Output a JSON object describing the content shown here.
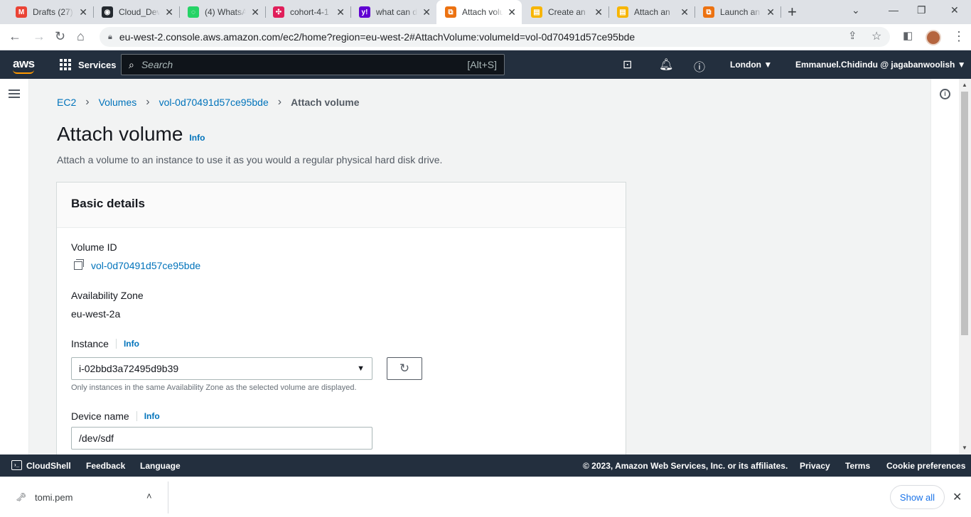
{
  "browser": {
    "tabs": [
      {
        "title": "Drafts (27)",
        "icon": "gmail-icon",
        "color": "#ea4335",
        "glyph": "M"
      },
      {
        "title": "Cloud_Dev",
        "icon": "github-icon",
        "color": "#24292f",
        "glyph": "◉"
      },
      {
        "title": "(4) WhatsA",
        "icon": "whatsapp-icon",
        "color": "#25d366",
        "glyph": "◌"
      },
      {
        "title": "cohort-4-1",
        "icon": "slack-icon",
        "color": "#e01e5a",
        "glyph": "✣"
      },
      {
        "title": "what can d",
        "icon": "yahoo-icon",
        "color": "#6001d2",
        "glyph": "y!"
      },
      {
        "title": "Attach volu",
        "icon": "aws-ec2-icon",
        "color": "#ec7211",
        "glyph": "⧉",
        "active": true
      },
      {
        "title": "Create an",
        "icon": "aws-docs-icon",
        "color": "#f7b500",
        "glyph": "▤"
      },
      {
        "title": "Attach an",
        "icon": "aws-docs-icon",
        "color": "#f7b500",
        "glyph": "▤"
      },
      {
        "title": "Launch an",
        "icon": "aws-ec2-icon",
        "color": "#ec7211",
        "glyph": "⧉"
      }
    ],
    "new_tab": "+",
    "url": "eu-west-2.console.aws.amazon.com/ec2/home?region=eu-west-2#AttachVolume:volumeId=vol-0d70491d57ce95bde"
  },
  "aws_nav": {
    "logo": "aws",
    "services": "Services",
    "search_placeholder": "Search",
    "search_shortcut": "[Alt+S]",
    "region": "London ▼",
    "account": "Emmanuel.Chidindu @ jagabanwoolish ▼"
  },
  "breadcrumb": {
    "items": [
      "EC2",
      "Volumes",
      "vol-0d70491d57ce95bde"
    ],
    "current": "Attach volume"
  },
  "page": {
    "title": "Attach volume",
    "title_info": "Info",
    "description": "Attach a volume to an instance to use it as you would a regular physical hard disk drive."
  },
  "basic_details": {
    "header": "Basic details",
    "volume_id_label": "Volume ID",
    "volume_id": "vol-0d70491d57ce95bde",
    "az_label": "Availability Zone",
    "az_value": "eu-west-2a",
    "instance_label": "Instance",
    "instance_info": "Info",
    "instance_value": "i-02bbd3a72495d9b39",
    "instance_hint": "Only instances in the same Availability Zone as the selected volume are displayed.",
    "device_label": "Device name",
    "device_info": "Info",
    "device_value": "/dev/sdf"
  },
  "footer": {
    "cloudshell": "CloudShell",
    "feedback": "Feedback",
    "language": "Language",
    "copyright": "© 2023, Amazon Web Services, Inc. or its affiliates.",
    "privacy": "Privacy",
    "terms": "Terms",
    "cookies": "Cookie preferences"
  },
  "downloads": {
    "file": "tomi.pem",
    "show_all": "Show all"
  }
}
